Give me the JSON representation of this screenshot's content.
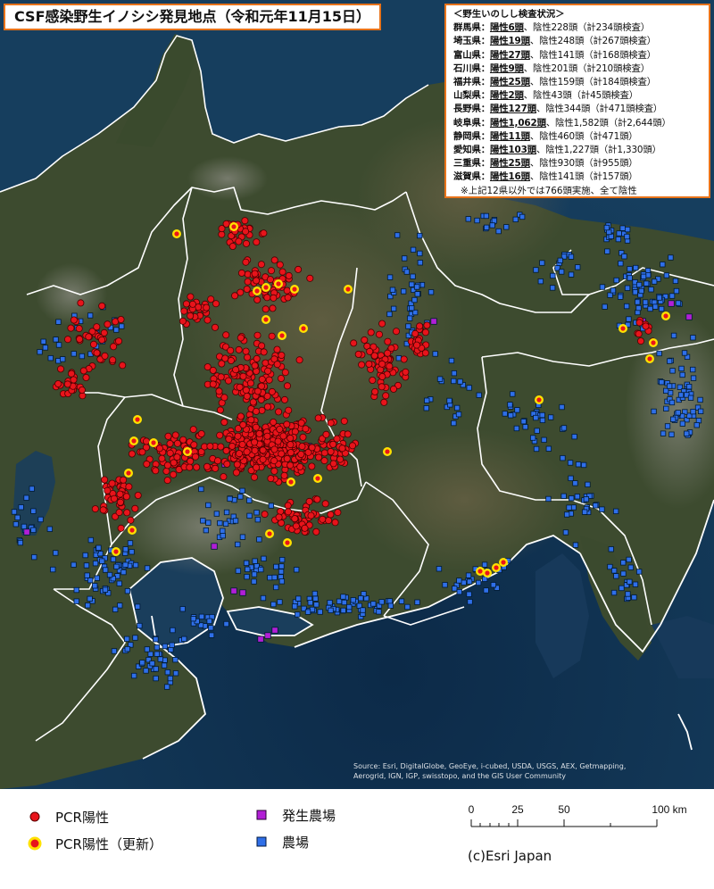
{
  "title": "CSF感染野生イノシシ発見地点（令和元年11月15日）",
  "status_box": {
    "heading": "＜野生いのしし検査状況＞",
    "rows": [
      {
        "pref": "群馬県：",
        "pos": "陽性6頭",
        "rest": "、陰性228頭（計234頭検査）"
      },
      {
        "pref": "埼玉県：",
        "pos": "陽性19頭",
        "rest": "、陰性248頭（計267頭検査）"
      },
      {
        "pref": "富山県：",
        "pos": "陽性27頭",
        "rest": "、陰性141頭（計168頭検査）"
      },
      {
        "pref": "石川県：",
        "pos": "陽性9頭",
        "rest": "、陰性201頭（計210頭検査）"
      },
      {
        "pref": "福井県：",
        "pos": "陽性25頭",
        "rest": "、陰性159頭（計184頭検査）"
      },
      {
        "pref": "山梨県：",
        "pos": "陽性2頭",
        "rest": "、陰性43頭（計45頭検査）"
      },
      {
        "pref": "長野県：",
        "pos": "陽性127頭",
        "rest": "、陰性344頭（計471頭検査）"
      },
      {
        "pref": "岐阜県：",
        "pos": "陽性1,062頭",
        "rest": "、陰性1,582頭（計2,644頭）"
      },
      {
        "pref": "静岡県：",
        "pos": "陽性11頭",
        "rest": "、陰性460頭（計471頭）"
      },
      {
        "pref": "愛知県：",
        "pos": "陽性103頭",
        "rest": "、陰性1,227頭（計1,330頭）"
      },
      {
        "pref": "三重県：",
        "pos": "陽性25頭",
        "rest": "、陰性930頭（計955頭）"
      },
      {
        "pref": "滋賀県：",
        "pos": "陽性16頭",
        "rest": "、陰性141頭（計157頭）"
      }
    ],
    "note": "※上記12県以外では766頭実施、全て陰性"
  },
  "source_text": {
    "line1": "Source: Esri, DigitalGlobe, GeoEye, i-cubed, USDA, USGS, AEX, Getmapping,",
    "line2": "Aerogrid, IGN, IGP, swisstopo, and the GIS User Community"
  },
  "legend": {
    "pcr_positive": "PCR陽性",
    "pcr_positive_updated": "PCR陽性（更新）",
    "outbreak_farm": "発生農場",
    "farm": "農場"
  },
  "scale_bar": {
    "ticks": [
      "0",
      "25",
      "50",
      "100 km"
    ]
  },
  "credit": "(c)Esri Japan",
  "colors": {
    "positive": "#e8141b",
    "updated_ring": "#ffe100",
    "outbreak_farm": "#b21fd6",
    "farm": "#2f6fe8",
    "border": "#ffffff",
    "box_border": "#e8731a",
    "sea": "#143552",
    "land": "#3a4a2e"
  }
}
